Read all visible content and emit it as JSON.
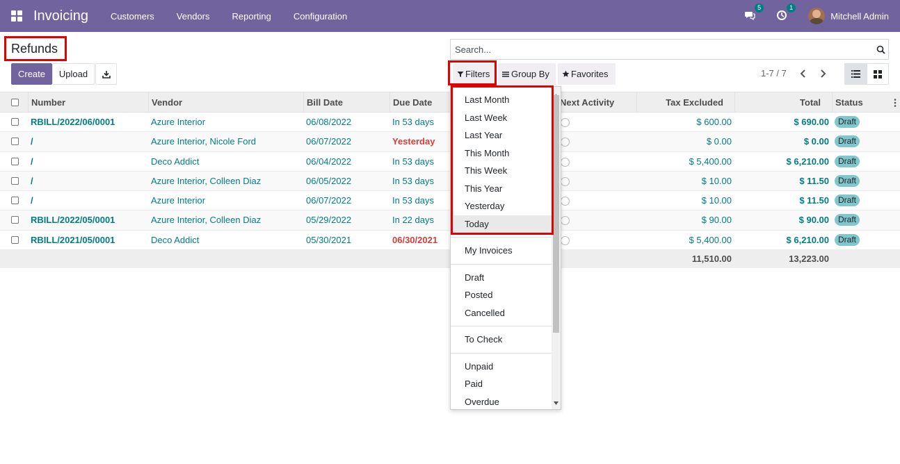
{
  "navbar": {
    "brand": "Invoicing",
    "menu": [
      "Customers",
      "Vendors",
      "Reporting",
      "Configuration"
    ],
    "messages_count": "5",
    "activities_count": "1",
    "user": "Mitchell Admin"
  },
  "page": {
    "title": "Refunds",
    "create_label": "Create",
    "upload_label": "Upload"
  },
  "search": {
    "placeholder": "Search...",
    "filters_label": "Filters",
    "groupby_label": "Group By",
    "favorites_label": "Favorites"
  },
  "pager": {
    "text": "1-7 / 7"
  },
  "table": {
    "columns": [
      "Number",
      "Vendor",
      "Bill Date",
      "Due Date",
      "Next Activity",
      "Tax Excluded",
      "Total",
      "Status"
    ],
    "rows": [
      {
        "number": "RBILL/2022/06/0001",
        "vendor": "Azure Interior",
        "bill_date": "06/08/2022",
        "due": "In 53 days",
        "tax_excl": "$ 600.00",
        "total": "$ 690.00",
        "status": "Draft"
      },
      {
        "number": "/",
        "vendor": "Azure Interior, Nicole Ford",
        "bill_date": "06/07/2022",
        "due": "Yesterday",
        "tax_excl": "$ 0.00",
        "total": "$ 0.00",
        "status": "Draft"
      },
      {
        "number": "/",
        "vendor": "Deco Addict",
        "bill_date": "06/04/2022",
        "due": "In 53 days",
        "tax_excl": "$ 5,400.00",
        "total": "$ 6,210.00",
        "status": "Draft"
      },
      {
        "number": "/",
        "vendor": "Azure Interior, Colleen Diaz",
        "bill_date": "06/05/2022",
        "due": "In 53 days",
        "tax_excl": "$ 10.00",
        "total": "$ 11.50",
        "status": "Draft"
      },
      {
        "number": "/",
        "vendor": "Azure Interior",
        "bill_date": "06/07/2022",
        "due": "In 53 days",
        "tax_excl": "$ 10.00",
        "total": "$ 11.50",
        "status": "Draft"
      },
      {
        "number": "RBILL/2022/05/0001",
        "vendor": "Azure Interior, Colleen Diaz",
        "bill_date": "05/29/2022",
        "due": "In 22 days",
        "tax_excl": "$ 90.00",
        "total": "$ 90.00",
        "status": "Draft"
      },
      {
        "number": "RBILL/2021/05/0001",
        "vendor": "Deco Addict",
        "bill_date": "05/30/2021",
        "due": "06/30/2021",
        "tax_excl": "$ 5,400.00",
        "total": "$ 6,210.00",
        "status": "Draft"
      }
    ],
    "footer": {
      "tax_excl_sum": "11,510.00",
      "total_sum": "13,223.00"
    }
  },
  "filters_menu": {
    "date_group": [
      "Last Month",
      "Last Week",
      "Last Year",
      "This Month",
      "This Week",
      "This Year",
      "Yesterday",
      "Today"
    ],
    "group2": [
      "My Invoices"
    ],
    "group3": [
      "Draft",
      "Posted",
      "Cancelled"
    ],
    "group4": [
      "To Check"
    ],
    "group5": [
      "Unpaid",
      "Paid",
      "Overdue"
    ]
  },
  "colors": {
    "brand": "#71639e",
    "link": "#017e84",
    "danger": "#d23f3a",
    "highlight": "#e30000"
  }
}
